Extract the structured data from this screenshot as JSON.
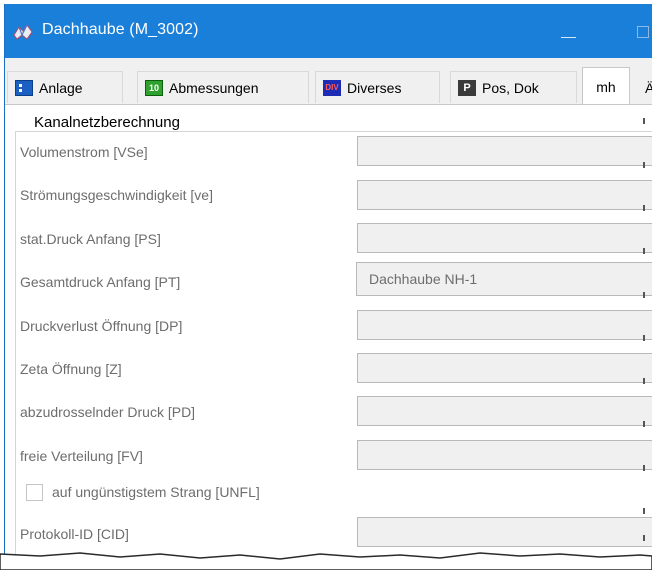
{
  "window": {
    "title": "Dachhaube (M_3002)",
    "accent_color": "#1a7fd8",
    "icons": [
      "app-icon",
      "minimize-icon",
      "restore-icon"
    ]
  },
  "tabs": [
    {
      "label": "Anlage",
      "icon": "anlage-icon",
      "active": false
    },
    {
      "label": "Abmessungen",
      "icon": "abmessungen-icon",
      "icon_text": "10",
      "active": false
    },
    {
      "label": "Diverses",
      "icon": "diverses-icon",
      "icon_text": "DIV",
      "active": false
    },
    {
      "label": "Pos, Dok",
      "icon": "pos-dok-icon",
      "icon_text": "P",
      "active": false
    },
    {
      "label": "mh",
      "active": true
    }
  ],
  "tab_overflow_text": "Ä",
  "group": {
    "title": "Kanalnetzberechnung"
  },
  "fields": [
    {
      "label": "Volumenstrom [VSe]",
      "value": ""
    },
    {
      "label": "Strömungsgeschwindigkeit [ve]",
      "value": ""
    },
    {
      "label": "stat.Druck Anfang [PS]",
      "value": ""
    },
    {
      "label": "Gesamtdruck Anfang [PT]",
      "value": "Dachhaube NH-1"
    },
    {
      "label": "Druckverlust Öffnung [DP]",
      "value": ""
    },
    {
      "label": "Zeta Öffnung [Z]",
      "value": ""
    },
    {
      "label": "abzudrosselnder Druck [PD]",
      "value": ""
    },
    {
      "label": "freie Verteilung [FV]",
      "value": ""
    }
  ],
  "checkbox": {
    "label": "auf ungünstigstem Strang [UNFL]",
    "checked": false
  },
  "last_field": {
    "label": "Protokoll-ID [CID]",
    "value": ""
  }
}
